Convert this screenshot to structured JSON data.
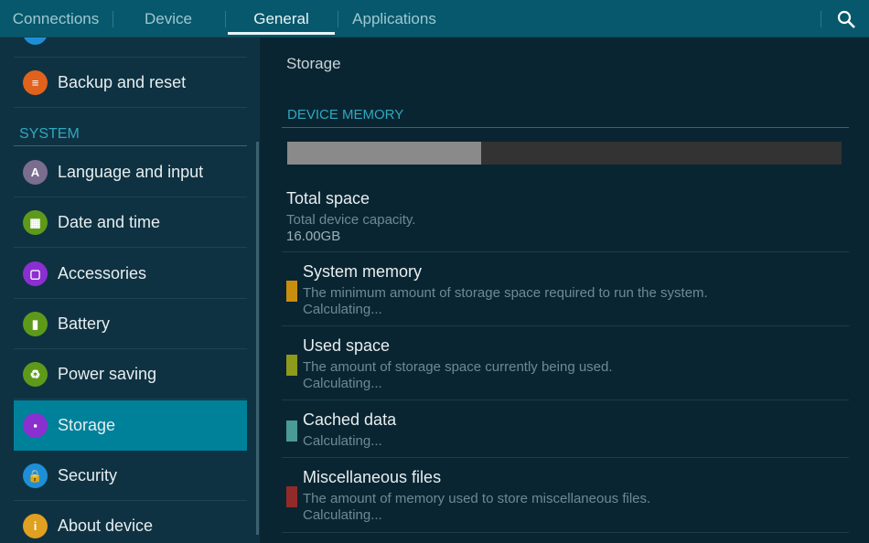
{
  "tabs": [
    {
      "label": "Connections"
    },
    {
      "label": "Device"
    },
    {
      "label": "General",
      "active": true
    },
    {
      "label": "Applications"
    }
  ],
  "search_icon": "search-icon",
  "sidebar": {
    "partial_item": {
      "icon_color": "#1e8fd6"
    },
    "backup": {
      "label": "Backup and reset",
      "icon_color": "#e0621c"
    },
    "section": "SYSTEM",
    "items": [
      {
        "label": "Language and input",
        "icon": "A",
        "icon_color": "#7a6d8e"
      },
      {
        "label": "Date and time",
        "icon": "▦",
        "icon_color": "#5e9a1a"
      },
      {
        "label": "Accessories",
        "icon": "▢",
        "icon_color": "#8a2fd0"
      },
      {
        "label": "Battery",
        "icon": "▮",
        "icon_color": "#5e9a1a"
      },
      {
        "label": "Power saving",
        "icon": "♻",
        "icon_color": "#5e9a1a"
      },
      {
        "label": "Storage",
        "icon": "▪",
        "icon_color": "#8a2fd0",
        "selected": true
      },
      {
        "label": "Security",
        "icon": "🔒",
        "icon_color": "#1e8fd6"
      },
      {
        "label": "About device",
        "icon": "i",
        "icon_color": "#e0a020"
      }
    ]
  },
  "main": {
    "title": "Storage",
    "section": "DEVICE MEMORY",
    "usage_fraction": 0.35,
    "total": {
      "title": "Total space",
      "desc": "Total device capacity.",
      "value": "16.00GB"
    },
    "rows": [
      {
        "title": "System memory",
        "desc": "The minimum amount of storage space required to run the system.",
        "value": "Calculating...",
        "color": "#c98e0e"
      },
      {
        "title": "Used space",
        "desc": "The amount of storage space currently being used.",
        "value": "Calculating...",
        "color": "#8e9a1c"
      },
      {
        "title": "Cached data",
        "value": "Calculating...",
        "color": "#4a9a96"
      },
      {
        "title": "Miscellaneous files",
        "desc": "The amount of memory used to store miscellaneous files.",
        "value": "Calculating...",
        "color": "#922a2a"
      }
    ]
  }
}
